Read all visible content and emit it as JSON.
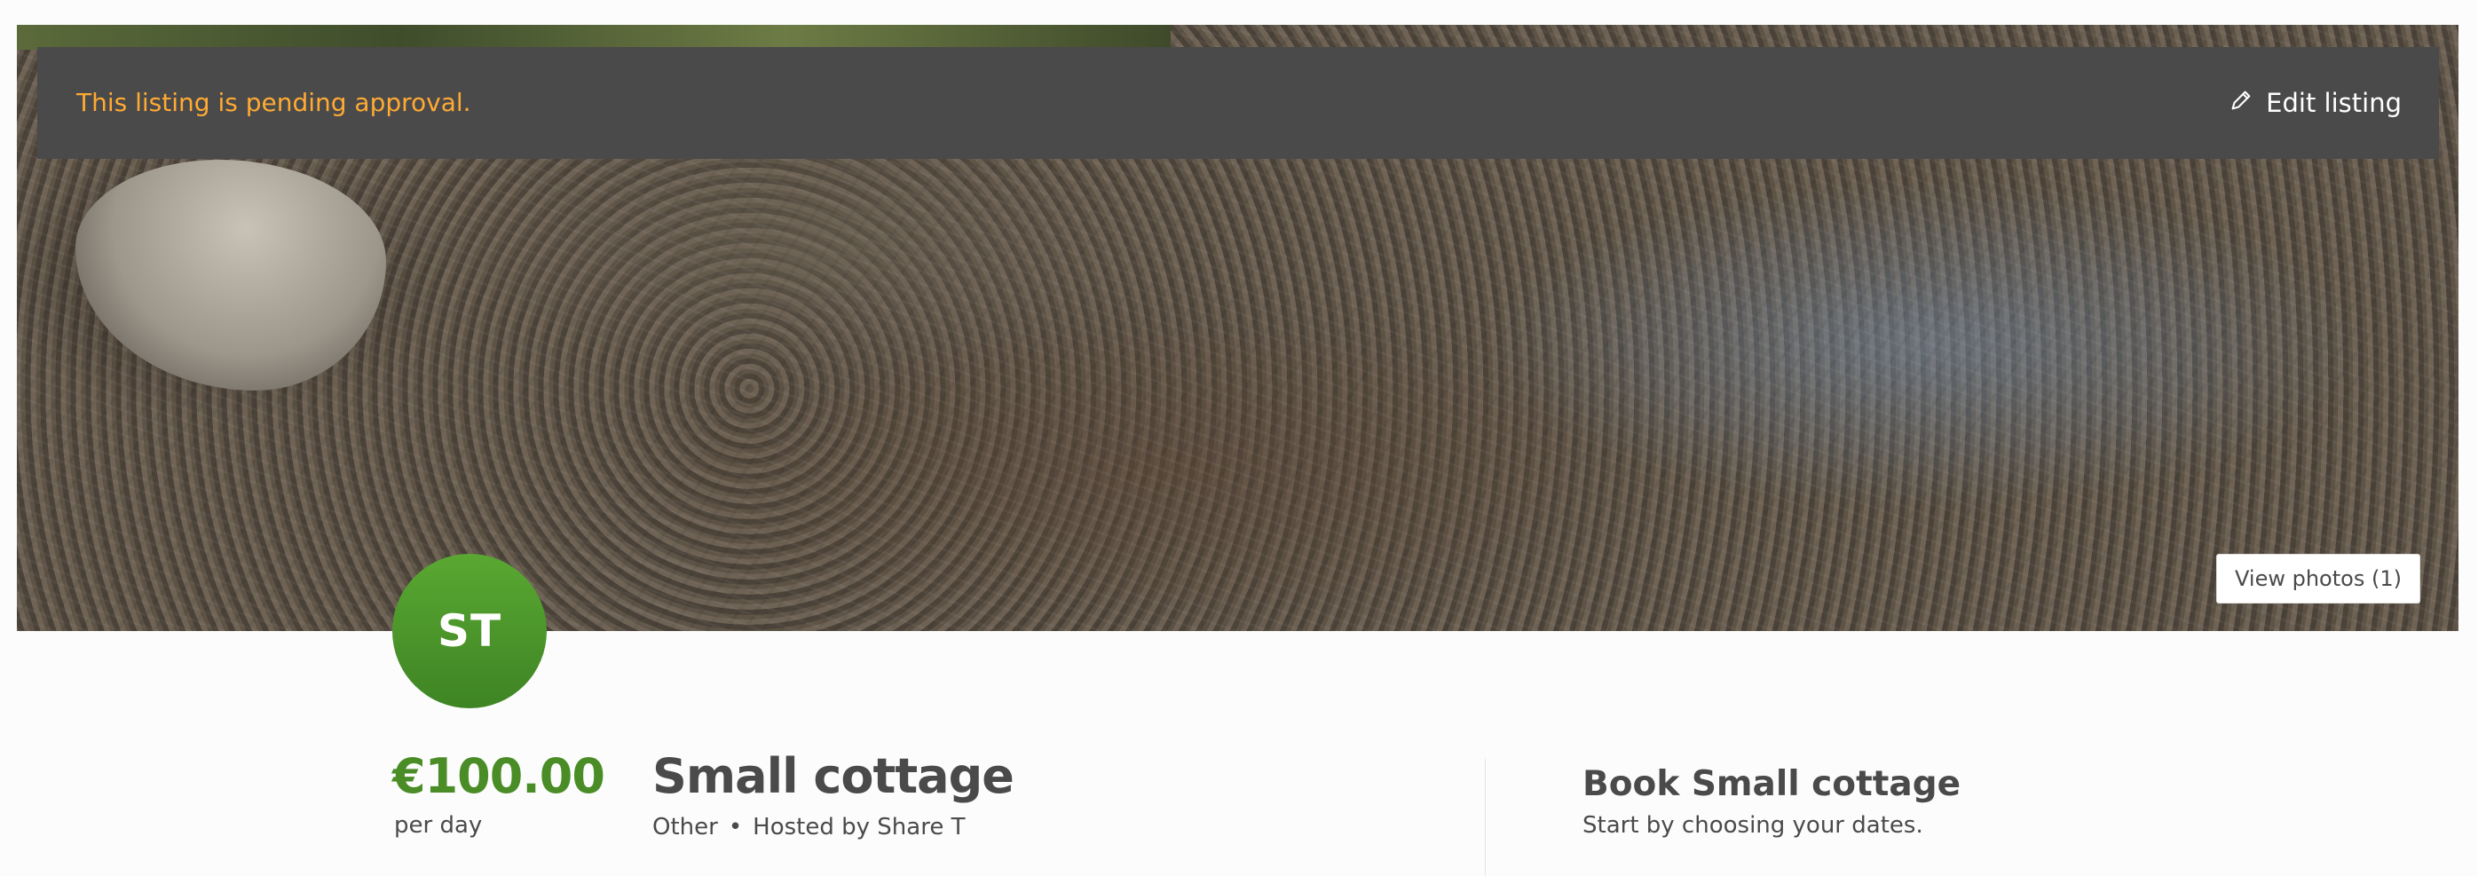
{
  "banner": {
    "pending_text": "This listing is pending approval.",
    "edit_label": "Edit listing"
  },
  "hero": {
    "view_photos_label": "View photos (1)"
  },
  "author": {
    "initials": "ST"
  },
  "listing": {
    "price": "€100.00",
    "per_unit": "per day",
    "title": "Small cottage",
    "category": "Other",
    "separator": "•",
    "hosted_by_prefix": "Hosted by ",
    "author_name": "Share T"
  },
  "booking": {
    "title": "Book Small cottage",
    "subtitle": "Start by choosing your dates."
  },
  "colors": {
    "accent": "#4a8c26",
    "pending": "#ffaa33",
    "banner_bg": "#4a4a4a"
  }
}
